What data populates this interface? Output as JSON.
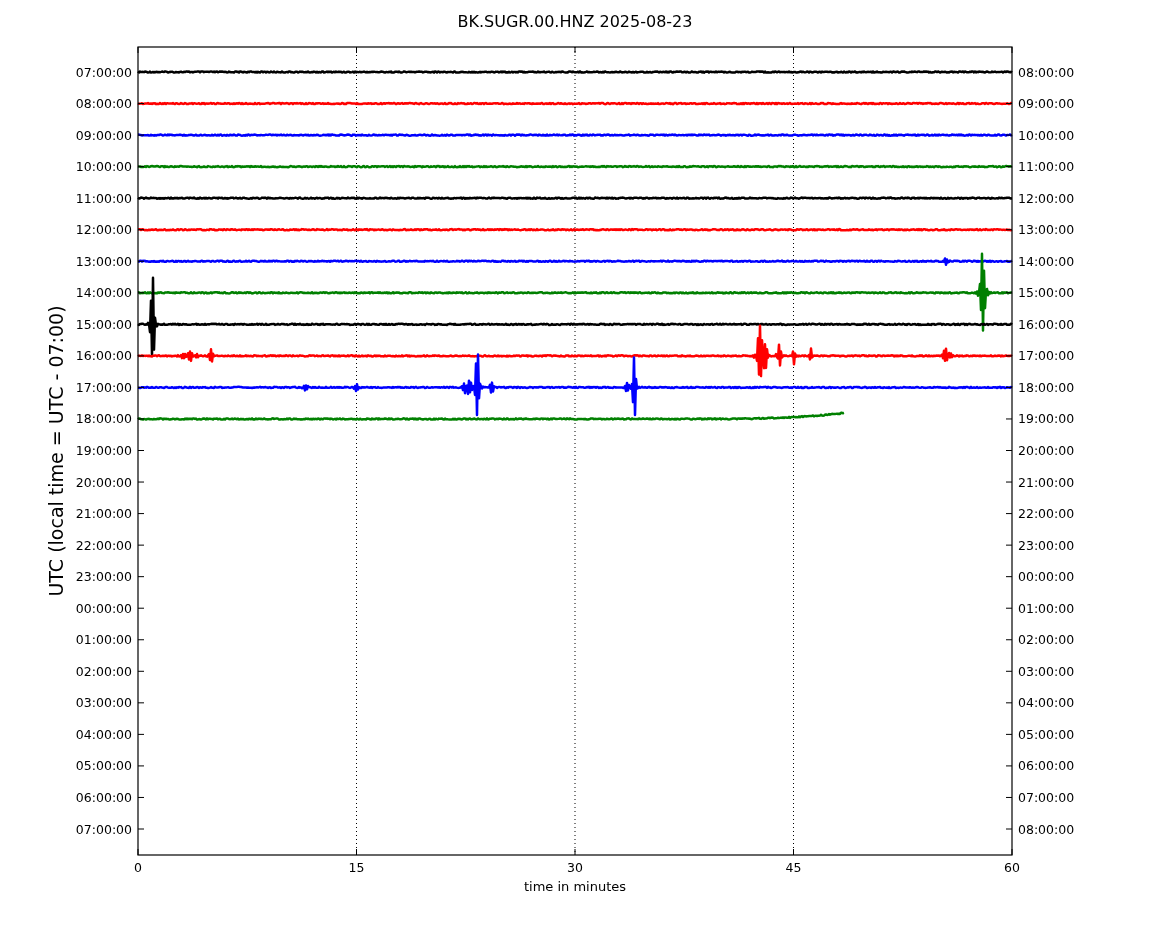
{
  "title": "BK.SUGR.00.HNZ 2025-08-23",
  "ylabel": "UTC (local time = UTC - 07:00)",
  "xlabel": "time in minutes",
  "xticks": [
    "0",
    "15",
    "30",
    "45",
    "60"
  ],
  "left_ticks": [
    "07:00:00",
    "08:00:00",
    "09:00:00",
    "10:00:00",
    "11:00:00",
    "12:00:00",
    "13:00:00",
    "14:00:00",
    "15:00:00",
    "16:00:00",
    "17:00:00",
    "18:00:00",
    "19:00:00",
    "20:00:00",
    "21:00:00",
    "22:00:00",
    "23:00:00",
    "00:00:00",
    "01:00:00",
    "02:00:00",
    "03:00:00",
    "04:00:00",
    "05:00:00",
    "06:00:00",
    "07:00:00"
  ],
  "right_ticks": [
    "08:00:00",
    "09:00:00",
    "10:00:00",
    "11:00:00",
    "12:00:00",
    "13:00:00",
    "14:00:00",
    "15:00:00",
    "16:00:00",
    "17:00:00",
    "18:00:00",
    "19:00:00",
    "20:00:00",
    "21:00:00",
    "22:00:00",
    "23:00:00",
    "00:00:00",
    "01:00:00",
    "02:00:00",
    "03:00:00",
    "04:00:00",
    "05:00:00",
    "06:00:00",
    "07:00:00",
    "08:00:00"
  ],
  "traces": [
    {
      "color": "#000000",
      "kind": "full"
    },
    {
      "color": "#ff0000",
      "kind": "full"
    },
    {
      "color": "#0000ff",
      "kind": "full"
    },
    {
      "color": "#008000",
      "kind": "full"
    },
    {
      "color": "#000000",
      "kind": "full"
    },
    {
      "color": "#ff0000",
      "kind": "full"
    },
    {
      "color": "#0000ff",
      "kind": "full"
    },
    {
      "color": "#008000",
      "kind": "full"
    },
    {
      "color": "#000000",
      "kind": "full"
    },
    {
      "color": "#ff0000",
      "kind": "full"
    },
    {
      "color": "#0000ff",
      "kind": "full"
    },
    {
      "color": "#008000",
      "kind": "partial"
    }
  ]
}
